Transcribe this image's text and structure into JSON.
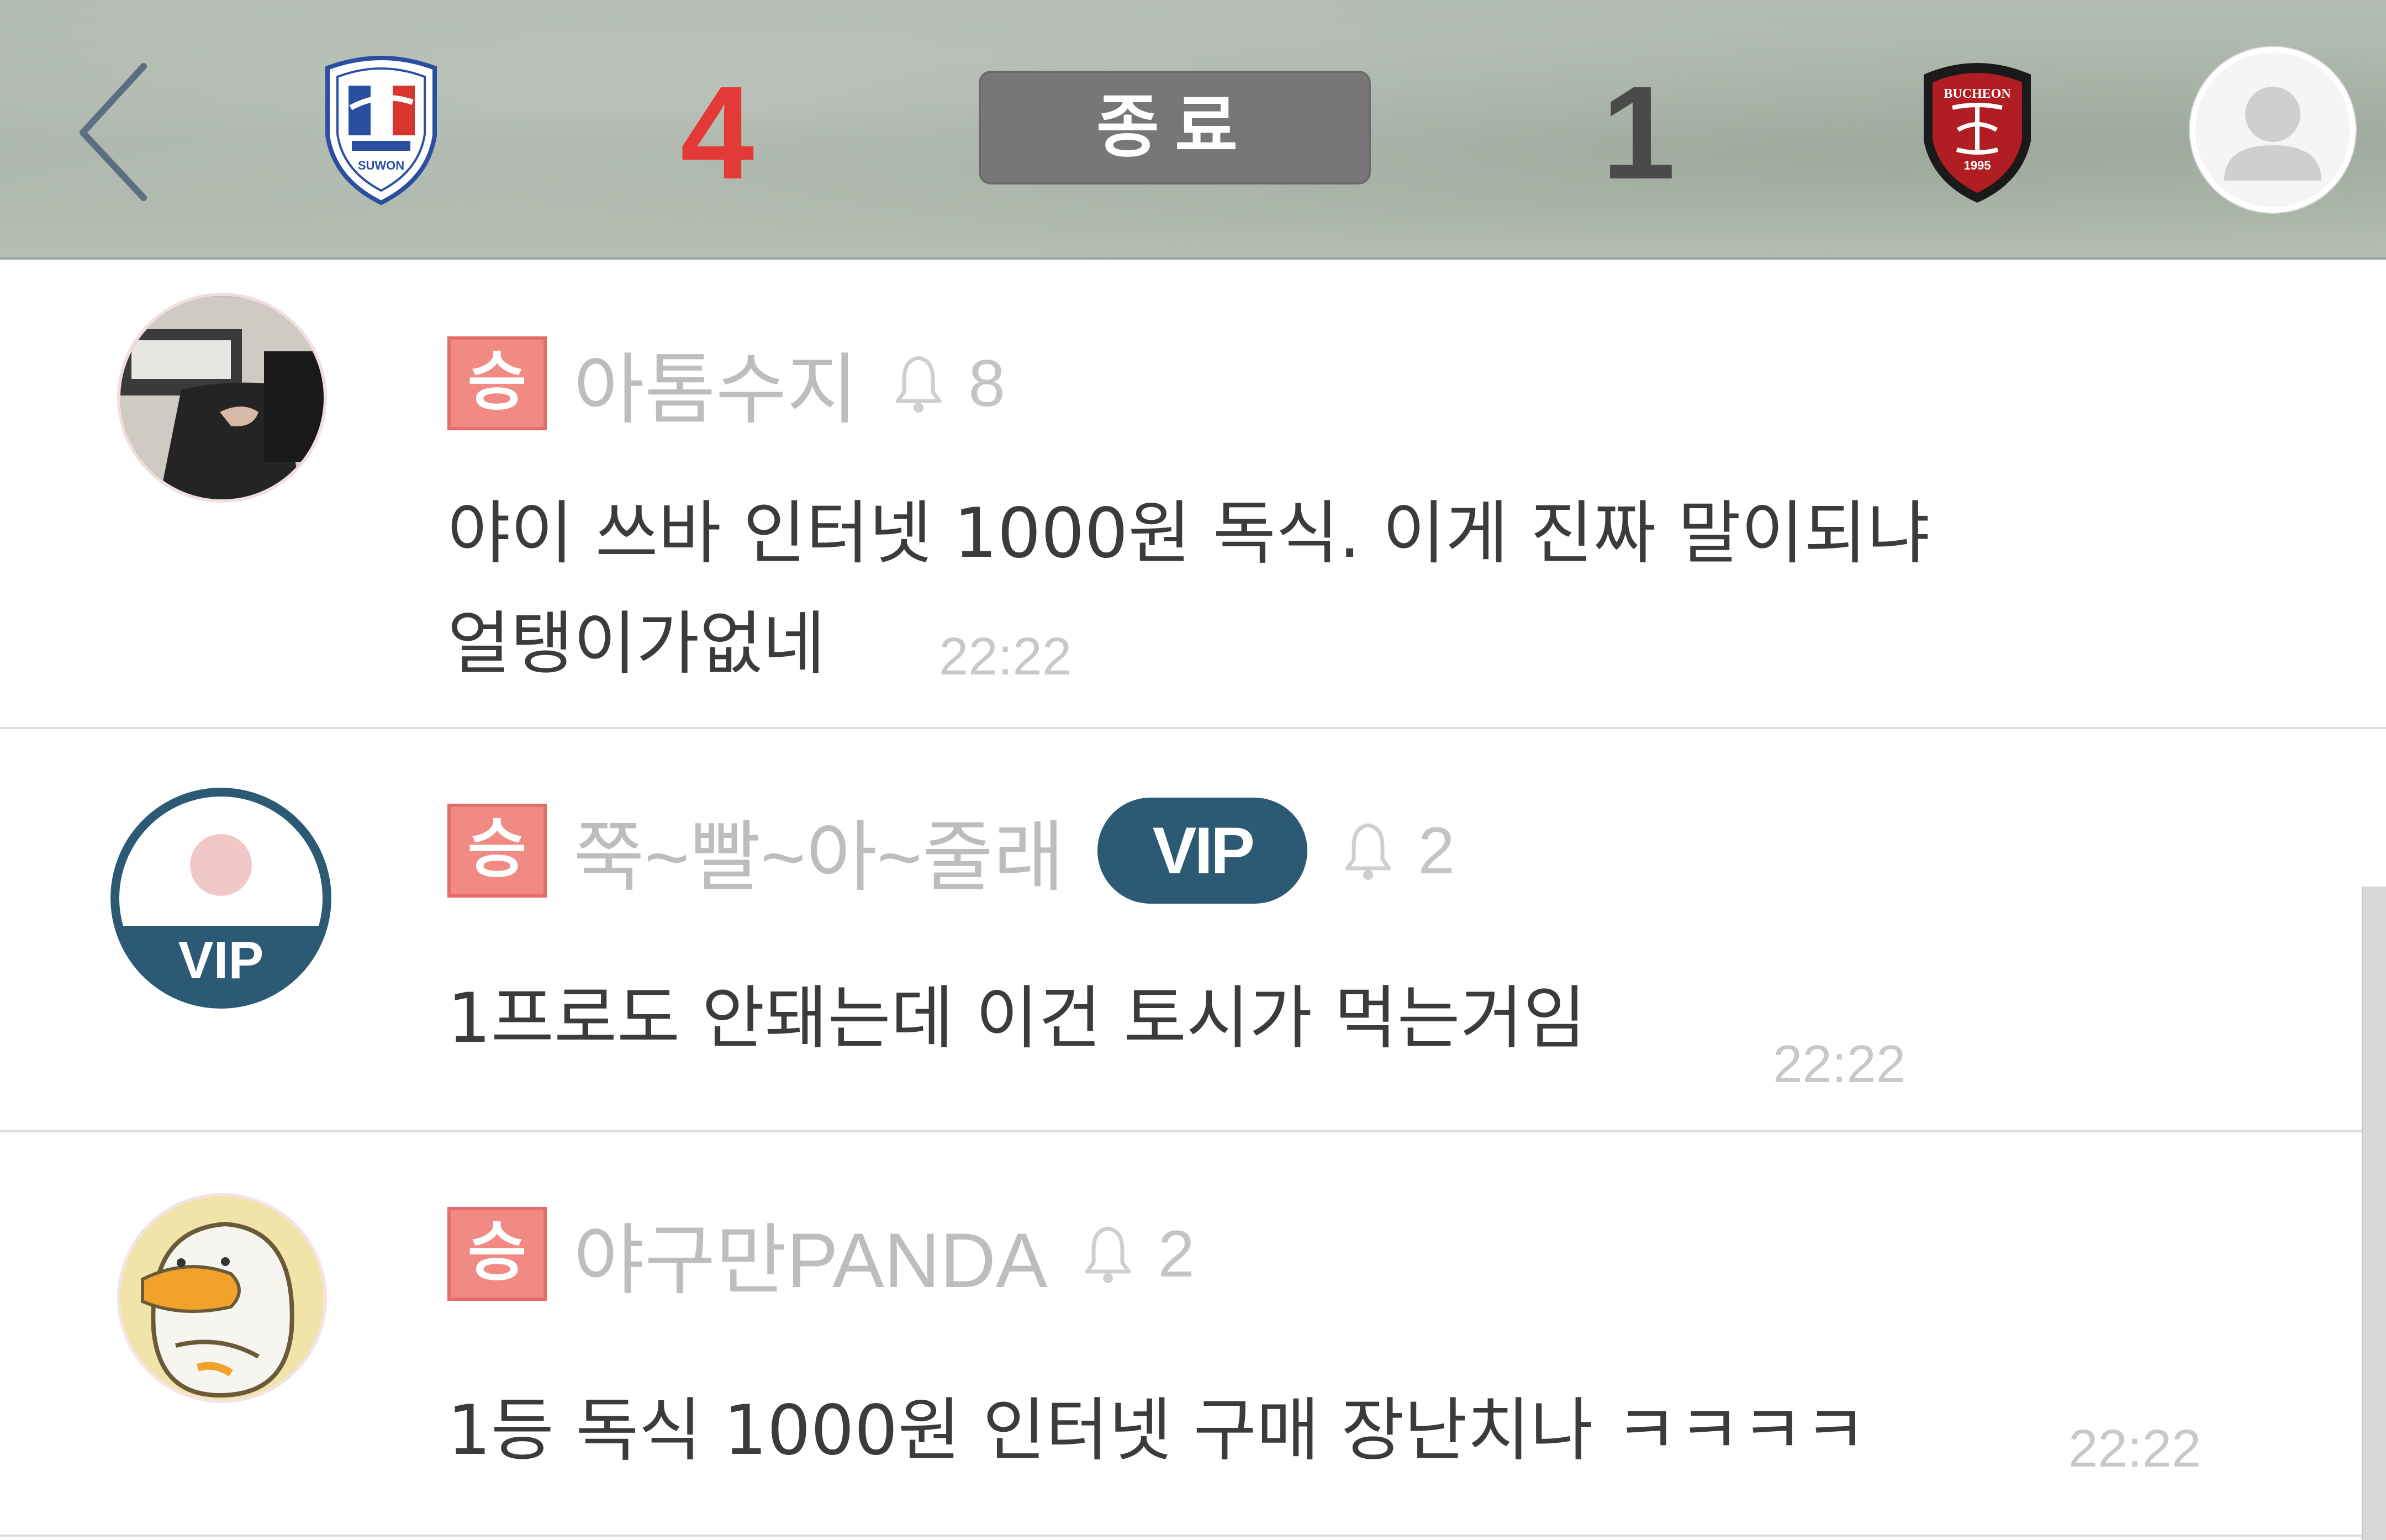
{
  "header": {
    "home_score": "4",
    "away_score": "1",
    "status": "종료",
    "home_logo_text": "SUWON",
    "away_logo_text": "BUCHEON",
    "away_logo_year": "1995",
    "home_color": "#e43a37",
    "away_color": "#4a4a4a"
  },
  "comments": [
    {
      "badge": "승",
      "nickname": "아톰수지",
      "bell_count": "8",
      "text_line1": "야이 쓰바 인터넷 1000원 독식. 이게 진짜 말이되냐",
      "text_line2": "얼탱이가없네",
      "time": "22:22"
    },
    {
      "badge": "승",
      "nickname": "쭉~빨~아~줄래",
      "vip_label": "VIP",
      "avatar_vip_label": "VIP",
      "bell_count": "2",
      "text_line1": "1프로도 안돼는데 이건 토시가 먹는거임",
      "time": "22:22"
    },
    {
      "badge": "승",
      "nickname": "야구만PANDA",
      "bell_count": "2",
      "text_line1": "1등 독식 1000원 인터넷 구매 장난치나 ㅋㅋㅋㅋ",
      "time": "22:22"
    }
  ],
  "icons": {
    "back": "chevron-left-icon",
    "profile": "user-icon",
    "bell": "bell-icon"
  },
  "colors": {
    "win_badge": "#f28a84",
    "vip_badge": "#2c5a75",
    "status_badge": "#777777"
  }
}
